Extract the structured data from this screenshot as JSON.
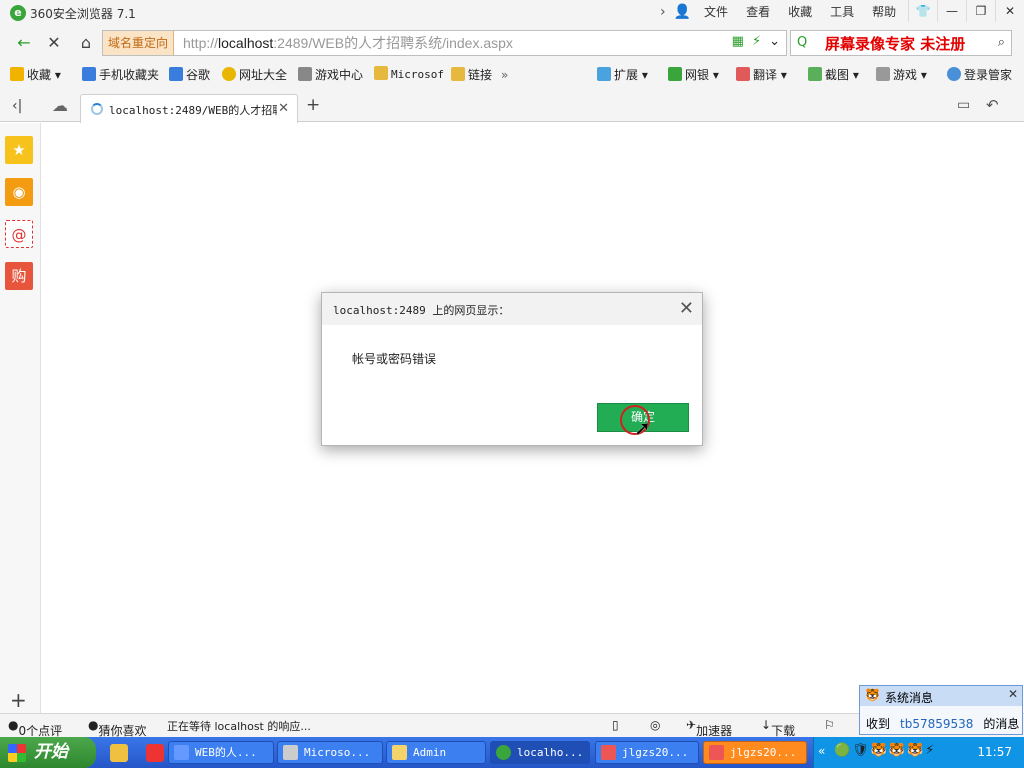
{
  "titlebar": {
    "app_title": "360安全浏览器 7.1",
    "menu": [
      "文件",
      "查看",
      "收藏",
      "工具",
      "帮助"
    ],
    "window_buttons": [
      "shirt-icon",
      "minimize-icon",
      "restore-icon",
      "close-icon"
    ]
  },
  "navbar": {
    "redirect_label": "域名重定向",
    "url_prefix": "http://",
    "url_host": "localhost",
    "url_rest": ":2489/WEB的人才招聘系统/index.aspx",
    "watermark": "屏幕录像专家 未注册"
  },
  "bookmarks": [
    {
      "label": "收藏",
      "icon": "star-add-icon",
      "color": "#f2b300"
    },
    {
      "label": "手机收藏夹",
      "icon": "phone-icon",
      "color": "#3b7ddd"
    },
    {
      "label": "谷歌",
      "icon": "google-icon",
      "color": "#3b7ddd"
    },
    {
      "label": "网址大全",
      "icon": "plus-circle-icon",
      "color": "#e8b500"
    },
    {
      "label": "游戏中心",
      "icon": "gamepad-icon",
      "color": "#555555"
    },
    {
      "label": "Microsof",
      "icon": "folder-icon",
      "color": "#e6b93e"
    },
    {
      "label": "链接",
      "icon": "folder-icon",
      "color": "#e6b93e"
    }
  ],
  "tools": [
    {
      "label": "扩展",
      "icon": "extensions-icon"
    },
    {
      "label": "网银",
      "icon": "shield-bank-icon"
    },
    {
      "label": "翻译",
      "icon": "translate-icon"
    },
    {
      "label": "截图",
      "icon": "scissors-icon"
    },
    {
      "label": "游戏",
      "icon": "game-icon"
    },
    {
      "label": "登录管家",
      "icon": "login-search-icon"
    }
  ],
  "tab": {
    "title": "localhost:2489/WEB的人才招聘"
  },
  "dialog": {
    "title": "localhost:2489 上的网页显示：",
    "message": "帐号或密码错误",
    "ok_label": "确定"
  },
  "statusbar": {
    "reviews": "0个点评",
    "guess": "猜你喜欢",
    "status": "正在等待 localhost 的响应...",
    "accelerator": "加速器",
    "download": "下载"
  },
  "popup": {
    "title": "系统消息",
    "prefix": "收到",
    "user": "tb57859538",
    "suffix": "的消息"
  },
  "taskbar": {
    "start": "开始",
    "items": [
      "WEB的人...",
      "Microso...",
      "Admin",
      "localho...",
      "jlgzs20...",
      "jlgzs20..."
    ],
    "clock": "11:57"
  }
}
